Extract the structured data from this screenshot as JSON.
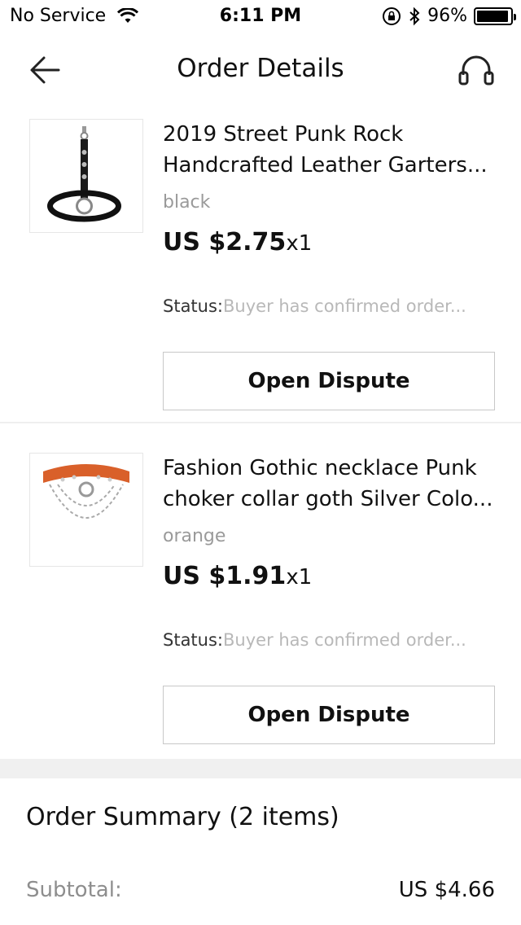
{
  "status_bar": {
    "carrier": "No Service",
    "time": "6:11 PM",
    "battery": "96%",
    "battery_level": 0.96
  },
  "header": {
    "title": "Order Details"
  },
  "items": [
    {
      "title_line1": "2019 Street Punk Rock",
      "title_line2": "Handcrafted Leather Garters...",
      "variant": "black",
      "price": "US $2.75",
      "qty": "x1",
      "status_label": "Status:",
      "status_value": "Buyer has confirmed order...",
      "button": "Open Dispute"
    },
    {
      "title_line1": "Fashion Gothic necklace Punk",
      "title_line2": "choker collar goth  Silver Colo...",
      "variant": "orange",
      "price": "US $1.91",
      "qty": "x1",
      "status_label": "Status:",
      "status_value": "Buyer has confirmed order...",
      "button": "Open Dispute"
    }
  ],
  "summary": {
    "title": "Order Summary (2 items)",
    "rows": [
      {
        "label": "Subtotal:",
        "value": "US $4.66"
      }
    ]
  },
  "icons": {
    "back": "arrow-left-icon",
    "support": "headset-icon",
    "wifi": "wifi-icon",
    "lock": "orientation-lock-icon",
    "bluetooth": "bluetooth-icon"
  }
}
